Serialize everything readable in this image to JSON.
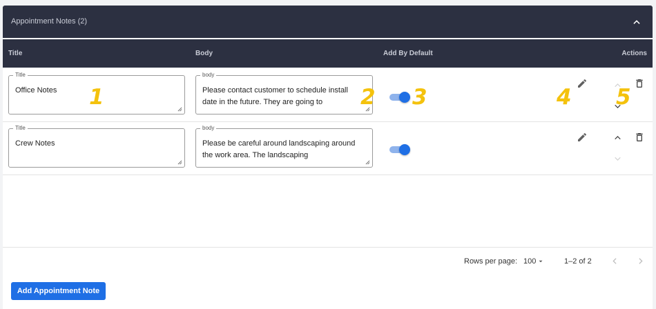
{
  "panel": {
    "title": "Appointment Notes (2)"
  },
  "columns": {
    "title": "Title",
    "body": "Body",
    "add_by_default": "Add By Default",
    "actions": "Actions"
  },
  "rows": [
    {
      "title_label": "Title",
      "title_value": "Office Notes",
      "body_label": "body",
      "body_value": "Please contact customer to schedule install date in the future. They are going to",
      "add_by_default": true
    },
    {
      "title_label": "Title",
      "title_value": "Crew Notes",
      "body_label": "body",
      "body_value": "Please be careful around landscaping around the work area. The landscaping",
      "add_by_default": true
    }
  ],
  "callouts": [
    "1",
    "2",
    "3",
    "4",
    "5"
  ],
  "pagination": {
    "rows_per_page_label": "Rows per page:",
    "rows_per_page_value": "100",
    "range": "1–2 of 2"
  },
  "add_button_label": "Add Appointment Note",
  "colors": {
    "header_bg": "#2c3041",
    "accent": "#1f6fe5",
    "callout": "#f4c20d"
  },
  "icons": [
    "chevron-up-icon",
    "pencil-icon",
    "chevron-down-icon",
    "trash-icon",
    "caret-down-icon",
    "chevron-left-icon",
    "chevron-right-icon"
  ]
}
